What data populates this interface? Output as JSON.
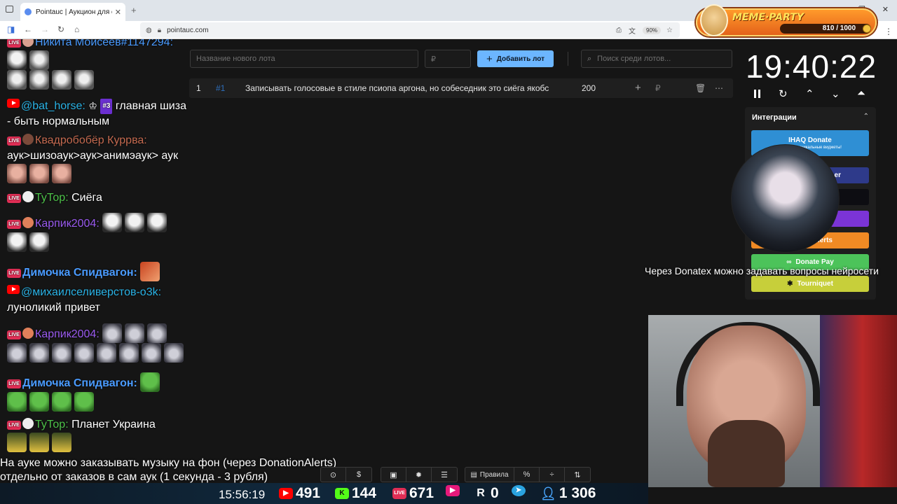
{
  "browser": {
    "tab_title": "Pointauc | Аукцион для стрима",
    "url": "pointauc.com",
    "zoom": "90%"
  },
  "meme_party": {
    "title": "MEME·PARTY",
    "progress_text": "810 / 1000",
    "current": 810,
    "max": 1000
  },
  "chat": {
    "messages": [
      {
        "author": "Никита Моисеев#1147294:",
        "text": ""
      },
      {
        "author": "@bat_horse:",
        "badge": "#3",
        "text": "главная шиза - быть нормальным"
      },
      {
        "author": "Квадробобёр Куррва:",
        "text": "аук>шизоаук>аук>анимэаук> аук"
      },
      {
        "author": "ТуТор:",
        "text": "Сиёга"
      },
      {
        "author": "Карпик2004:",
        "text": ""
      },
      {
        "author": "Димочка Спидвагон:",
        "text": ""
      },
      {
        "author": "@михаилселиверстов-o3k:",
        "text": "луноликий привет"
      },
      {
        "author": "Карпик2004:",
        "text": ""
      },
      {
        "author": "Димочка Спидвагон:",
        "text": ""
      },
      {
        "author": "ТуТор:",
        "text": "Планет Украина"
      }
    ]
  },
  "auction": {
    "new_lot_placeholder": "Название нового лота",
    "amount_placeholder": "₽",
    "add_button": "Добавить лот",
    "search_placeholder": "Поиск среди лотов...",
    "lots": [
      {
        "index": "1",
        "id": "#1",
        "name": "Записывать голосовые в стиле псиопа аргона, но собеседник это сиёга якобс",
        "amount": "200",
        "currency": "₽"
      }
    ]
  },
  "timer": {
    "value": "19:40:22"
  },
  "integrations": {
    "title": "Интеграции",
    "ihaq": "IHAQ Donate",
    "ihaq_sub": "Классные уникальные виджеты!",
    "partial_1": "er",
    "partial_2": "lerts",
    "donate_pay": "Donate Pay",
    "tourniquet": "Tourniquet"
  },
  "overlay_caption": "Через Donatex можно задавать вопросы нейросети",
  "bottom_caption": {
    "line1": "На ауке можно заказывать музыку на фон (через DonationAlerts)",
    "line2": "отдельно от заказов в сам аук (1 секунда - 3 рубля)"
  },
  "toolbar": {
    "rules": "Правила"
  },
  "stream_stats": {
    "clock": "15:56:19",
    "youtube": "491",
    "kick": "144",
    "twitch_live": "671",
    "rutube": "0",
    "telegram": "",
    "viewers_total": "1 306"
  },
  "colors": {
    "accent_button": "#6cb6ff",
    "live_badge": "#e02e55",
    "donate_pay": "#4cc35a",
    "tourniquet": "#c7cf3a",
    "alerts": "#f08a24"
  }
}
